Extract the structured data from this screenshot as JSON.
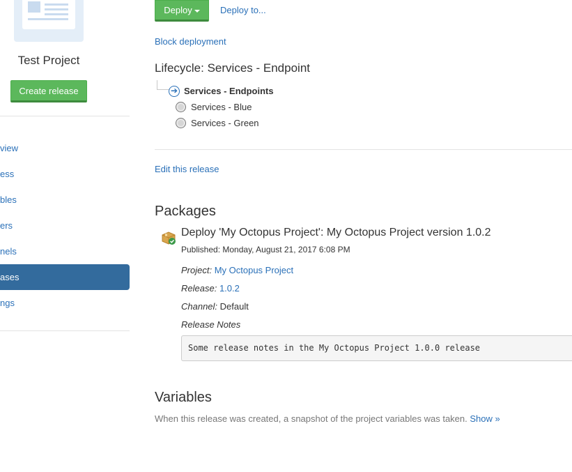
{
  "sidebar": {
    "project_name": "Test Project",
    "create_release_label": "Create release",
    "nav": [
      {
        "label": "Overview",
        "visible": "view",
        "active": false
      },
      {
        "label": "Process",
        "visible": "ess",
        "active": false
      },
      {
        "label": "Variables",
        "visible": "bles",
        "active": false
      },
      {
        "label": "Triggers",
        "visible": "ers",
        "active": false
      },
      {
        "label": "Channels",
        "visible": "nels",
        "active": false
      },
      {
        "label": "Releases",
        "visible": "ases",
        "active": true
      },
      {
        "label": "Settings",
        "visible": "ngs",
        "active": false
      }
    ]
  },
  "toolbar": {
    "deploy_label": "Deploy",
    "deploy_to_label": "Deploy to...",
    "block_deployment_label": "Block deployment"
  },
  "lifecycle": {
    "title": "Lifecycle: Services - Endpoint",
    "phases": [
      {
        "name": "Services - Endpoints",
        "current": true
      },
      {
        "name": "Services - Blue",
        "current": false
      },
      {
        "name": "Services - Green",
        "current": false
      }
    ]
  },
  "edit_release_label": "Edit this release",
  "packages": {
    "heading": "Packages",
    "title": "Deploy 'My Octopus Project': My Octopus Project version 1.0.2",
    "published": "Published: Monday, August 21, 2017 6:08 PM",
    "project_key": "Project:",
    "project_value": "My Octopus Project",
    "release_key": "Release:",
    "release_value": "1.0.2",
    "channel_key": "Channel:",
    "channel_value": "Default",
    "notes_heading": "Release Notes",
    "notes_text": "Some release notes in the My Octopus Project 1.0.0 release"
  },
  "variables": {
    "heading": "Variables",
    "text": "When this release was created, a snapshot of the project variables was taken.",
    "show_label": "Show »"
  },
  "colors": {
    "primary_green": "#5cb85c",
    "link_blue": "#2a70b8",
    "active_nav": "#336b9d"
  }
}
